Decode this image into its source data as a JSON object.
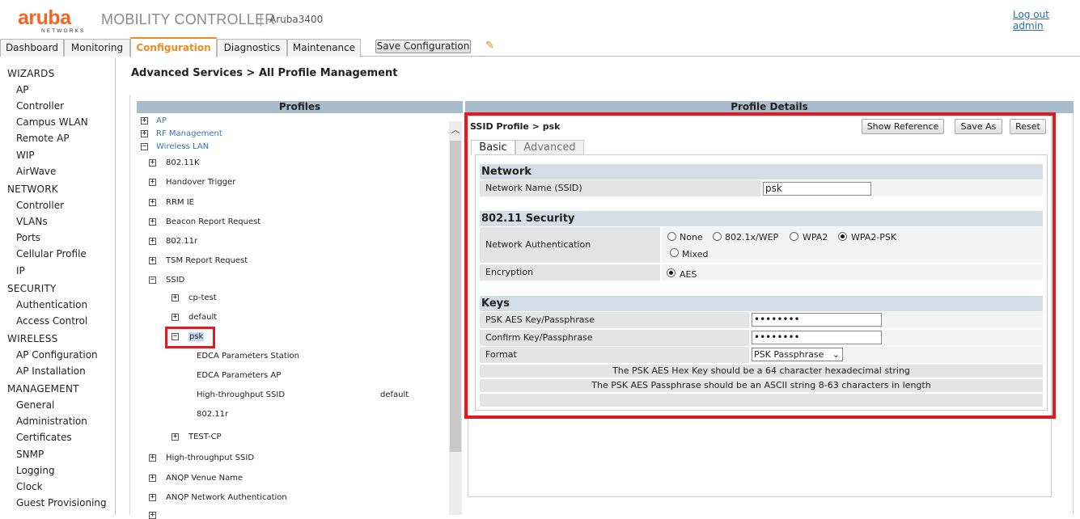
{
  "header": {
    "logo_text": "aruba",
    "logo_sub": "NETWORKS",
    "app_title": "MOBILITY CONTROLLER",
    "separator": "|",
    "hostname": "Aruba3400",
    "logout": "Log out admin"
  },
  "tabs": [
    "Dashboard",
    "Monitoring",
    "Configuration",
    "Diagnostics",
    "Maintenance"
  ],
  "active_tab": "Configuration",
  "save_configuration": "Save Configuration",
  "sidebar": {
    "sections": [
      {
        "title": "WIZARDS",
        "items": [
          "AP",
          "Controller",
          "Campus WLAN",
          "Remote AP",
          "WIP",
          "AirWave"
        ]
      },
      {
        "title": "NETWORK",
        "items": [
          "Controller",
          "VLANs",
          "Ports",
          "Cellular Profile",
          "IP"
        ]
      },
      {
        "title": "SECURITY",
        "items": [
          "Authentication",
          "Access Control"
        ]
      },
      {
        "title": "WIRELESS",
        "items": [
          "AP Configuration",
          "AP Installation"
        ]
      },
      {
        "title": "MANAGEMENT",
        "items": [
          "General",
          "Administration",
          "Certificates",
          "SNMP",
          "Logging",
          "Clock",
          "Guest Provisioning"
        ]
      }
    ]
  },
  "page_title": "Advanced Services > All Profile Management",
  "profiles": {
    "header": "Profiles",
    "tree": {
      "ap": "AP",
      "rf_management": "RF Management",
      "wireless_lan": "Wireless LAN",
      "dot11k": "802.11K",
      "handover_trigger": "Handover Trigger",
      "rrm_ie": "RRM IE",
      "beacon_report_request": "Beacon Report Request",
      "dot11r": "802.11r",
      "tsm_report_request": "TSM Report Request",
      "ssid": "SSID",
      "cp_test": "cp-test",
      "default": "default",
      "psk": "psk",
      "edca_station": "EDCA Parameters Station",
      "edca_ap": "EDCA Parameters AP",
      "ht_ssid": "High-throughput SSID",
      "ht_ssid_value": "default",
      "psk_dot11r": "802.11r",
      "test_cp": "TEST-CP",
      "ht_ssid_root": "High-throughput SSID",
      "anqp_venue_name": "ANQP Venue Name",
      "anqp_network_auth": "ANQP Network Authentication"
    }
  },
  "details": {
    "header": "Profile Details",
    "breadcrumb": "SSID Profile > psk",
    "buttons": {
      "show_reference": "Show Reference",
      "save_as": "Save As",
      "reset": "Reset"
    },
    "subtabs": {
      "basic": "Basic",
      "advanced": "Advanced"
    },
    "network": {
      "title": "Network",
      "ssid_label": "Network Name (SSID)",
      "ssid_value": "psk"
    },
    "security": {
      "title": "802.11 Security",
      "auth_label": "Network Authentication",
      "auth_options": [
        "None",
        "802.1x/WEP",
        "WPA2",
        "WPA2-PSK",
        "Mixed"
      ],
      "auth_selected": "WPA2-PSK",
      "encryption_label": "Encryption",
      "encryption_value": "AES"
    },
    "keys": {
      "title": "Keys",
      "psk_label": "PSK AES Key/Passphrase",
      "psk_value": "••••••••",
      "confirm_label": "Confirm Key/Passphrase",
      "confirm_value": "••••••••",
      "format_label": "Format",
      "format_value": "PSK Passphrase",
      "note_hex": "The PSK AES Hex Key should be a 64 character hexadecimal string",
      "note_ascii": "The PSK AES Passphrase should be an ASCII string 8-63 characters in length"
    }
  },
  "colors": {
    "brand": "#f26522",
    "active_tab": "#f08a24",
    "highlight": "#e01b24",
    "panel_header": "#a9bccc",
    "link": "#2a6fb5"
  }
}
